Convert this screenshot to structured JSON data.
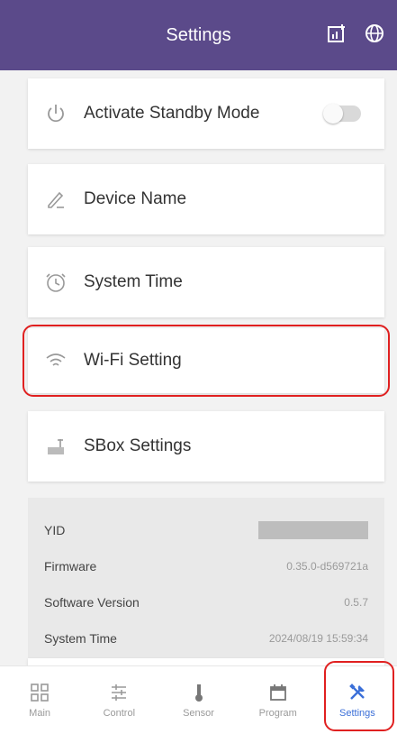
{
  "colors": {
    "header_bg": "#5b4a8a",
    "highlight": "#e02020",
    "active_tab": "#3b6fd8"
  },
  "header": {
    "title": "Settings",
    "icons": [
      "chart-add-icon",
      "globe-icon"
    ]
  },
  "cards": [
    {
      "label": "Activate Standby Mode",
      "icon": "power-icon",
      "toggle": false
    },
    {
      "label": "Device Name",
      "icon": "pencil-icon"
    },
    {
      "label": "System Time",
      "icon": "clock-icon"
    },
    {
      "label": "Wi-Fi Setting",
      "icon": "wifi-icon",
      "highlighted": true
    },
    {
      "label": "SBox Settings",
      "icon": "router-icon"
    }
  ],
  "info": {
    "rows": [
      {
        "label": "YID",
        "value": ""
      },
      {
        "label": "Firmware",
        "value": "0.35.0-d569721a"
      },
      {
        "label": "Software Version",
        "value": "0.5.7"
      },
      {
        "label": "System Time",
        "value": "2024/08/19 15:59:34"
      }
    ]
  },
  "tabs": [
    {
      "label": "Main",
      "icon": "grid-icon",
      "active": false
    },
    {
      "label": "Control",
      "icon": "sliders-icon",
      "active": false
    },
    {
      "label": "Sensor",
      "icon": "thermometer-icon",
      "active": false
    },
    {
      "label": "Program",
      "icon": "calendar-icon",
      "active": false
    },
    {
      "label": "Settings",
      "icon": "tools-icon",
      "active": true
    }
  ]
}
